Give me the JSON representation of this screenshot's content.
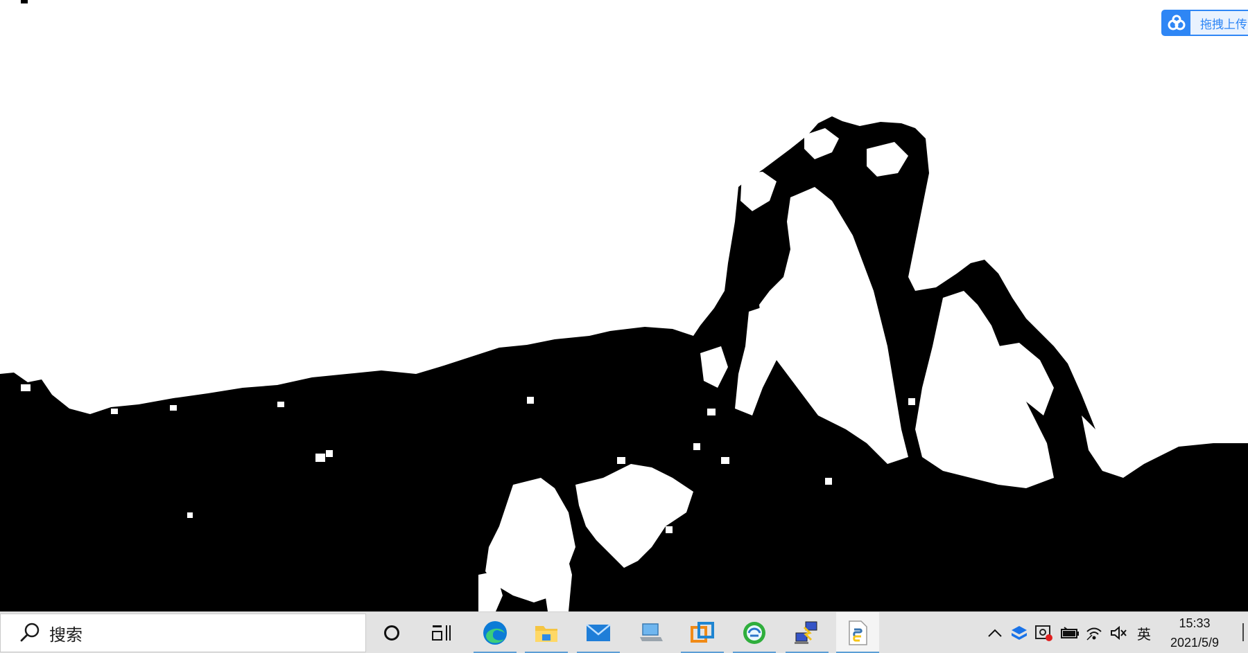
{
  "desktop": {
    "wallpaper": "binary-threshold-mountain-image"
  },
  "upload_widget": {
    "icon": "baidu-netdisk-cloud-icon",
    "label": "拖拽上传",
    "accent": "#2e86f5"
  },
  "taskbar": {
    "search": {
      "icon": "search-icon",
      "placeholder": "搜索"
    },
    "buttons": [
      {
        "name": "cortana",
        "icon": "cortana-ring-icon"
      },
      {
        "name": "task-view",
        "icon": "task-view-icon"
      },
      {
        "name": "edge",
        "icon": "edge-browser-icon"
      },
      {
        "name": "file-explorer",
        "icon": "folder-icon"
      },
      {
        "name": "mail",
        "icon": "mail-icon"
      },
      {
        "name": "laptop-app",
        "icon": "laptop-icon"
      },
      {
        "name": "vmware",
        "icon": "vmware-icon"
      },
      {
        "name": "app-green",
        "icon": "green-globe-icon"
      },
      {
        "name": "network-app",
        "icon": "network-computers-icon"
      },
      {
        "name": "python-file",
        "icon": "python-file-icon"
      }
    ],
    "tray": {
      "icons": [
        "chevron-up-icon",
        "dropbox-icon",
        "screen-record-icon",
        "battery-icon",
        "wifi-icon",
        "volume-muted-icon"
      ],
      "language": "英",
      "time": "15:33",
      "date": "2021/5/9"
    }
  }
}
